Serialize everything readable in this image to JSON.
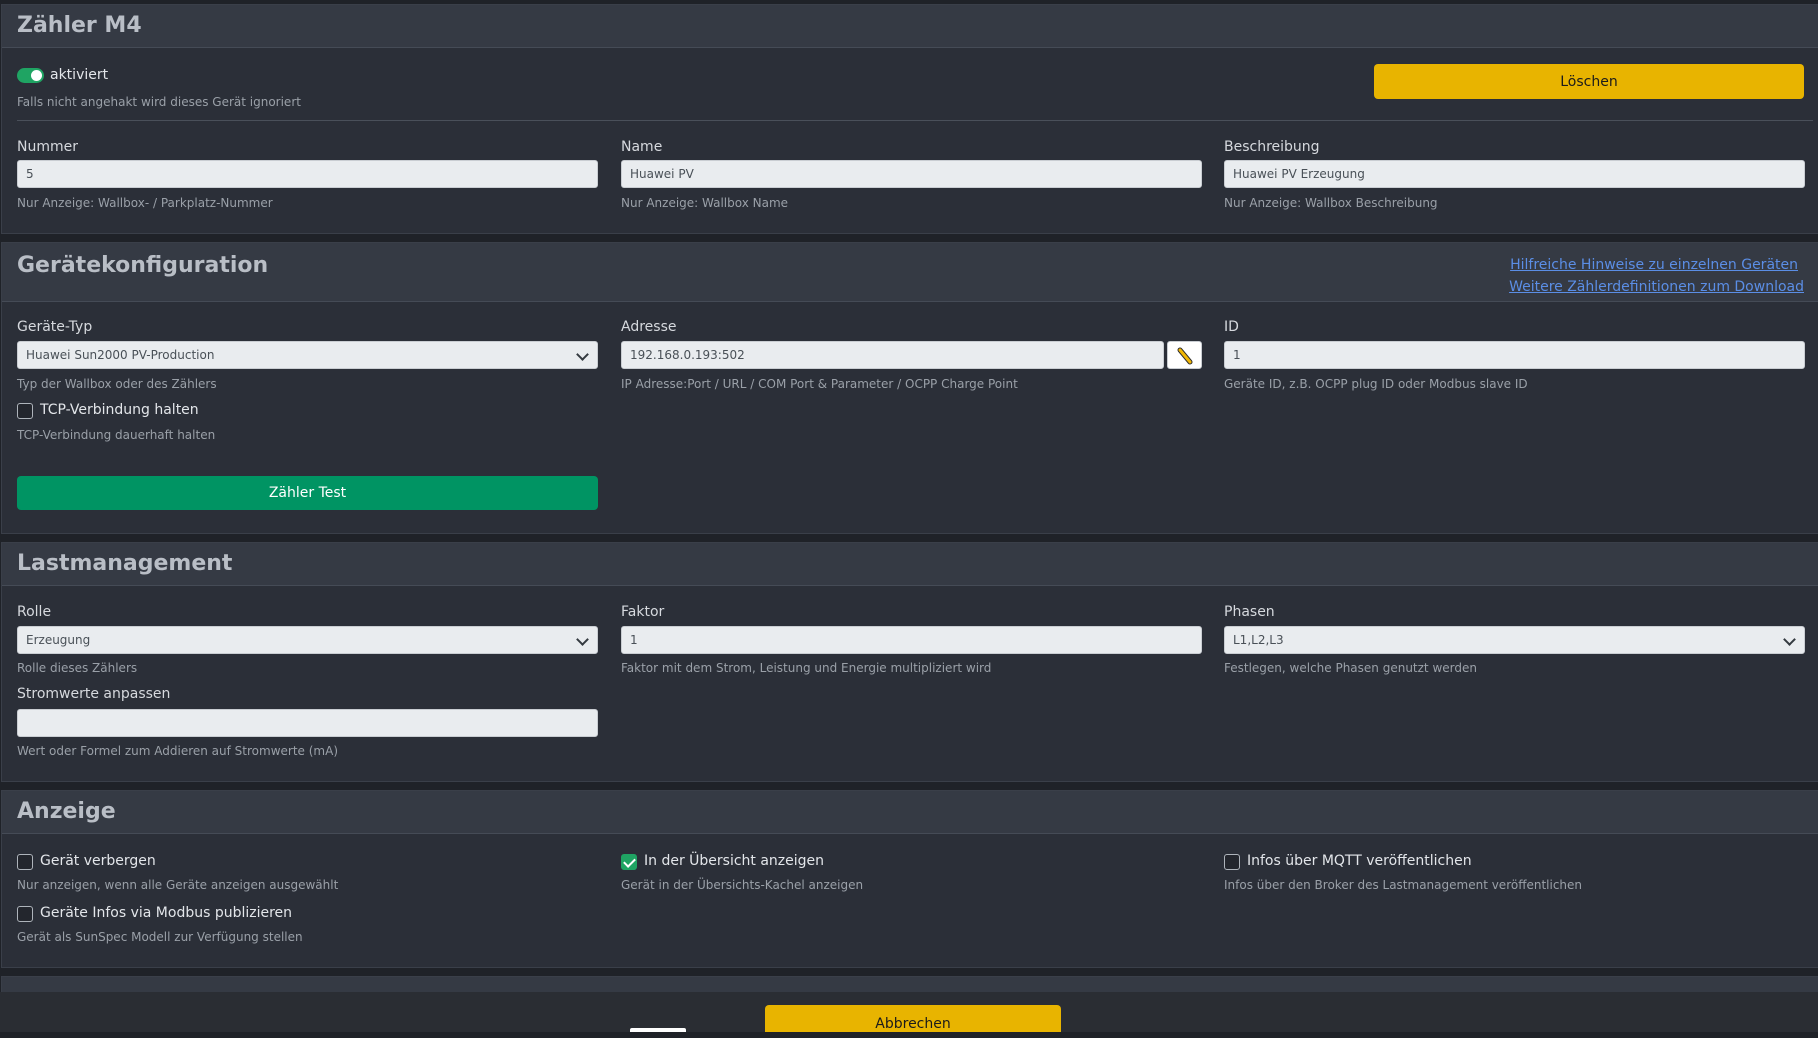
{
  "meter": {
    "title": "Zähler M4",
    "enabled_label": "aktiviert",
    "enabled_hint": "Falls nicht angehakt wird dieses Gerät ignoriert",
    "delete_label": "Löschen",
    "number": {
      "label": "Nummer",
      "value": "5",
      "hint": "Nur Anzeige: Wallbox- / Parkplatz-Nummer"
    },
    "name": {
      "label": "Name",
      "value": "Huawei PV",
      "hint": "Nur Anzeige: Wallbox Name"
    },
    "description": {
      "label": "Beschreibung",
      "value": "Huawei PV Erzeugung",
      "hint": "Nur Anzeige: Wallbox Beschreibung"
    }
  },
  "device": {
    "title": "Gerätekonfiguration",
    "link1": "Hilfreiche Hinweise zu einzelnen Geräten",
    "link2": "Weitere Zählerdefinitionen zum Download",
    "type": {
      "label": "Geräte-Typ",
      "value": "Huawei Sun2000 PV-Production",
      "hint": "Typ der Wallbox oder des Zählers"
    },
    "address": {
      "label": "Adresse",
      "value": "192.168.0.193:502",
      "hint": "IP Adresse:Port / URL / COM Port & Parameter / OCPP Charge Point"
    },
    "id": {
      "label": "ID",
      "value": "1",
      "hint": "Geräte ID, z.B. OCPP plug ID oder Modbus slave ID"
    },
    "tcp_label": "TCP-Verbindung halten",
    "tcp_hint": "TCP-Verbindung dauerhaft halten",
    "test_label": "Zähler Test"
  },
  "load": {
    "title": "Lastmanagement",
    "role": {
      "label": "Rolle",
      "value": "Erzeugung",
      "hint": "Rolle dieses Zählers"
    },
    "factor": {
      "label": "Faktor",
      "value": "1",
      "hint": "Faktor mit dem Strom, Leistung und Energie multipliziert wird"
    },
    "phases": {
      "label": "Phasen",
      "value": "L1,L2,L3",
      "hint": "Festlegen, welche Phasen genutzt werden"
    },
    "adjust": {
      "label": "Stromwerte anpassen",
      "value": "",
      "hint": "Wert oder Formel zum Addieren auf Stromwerte (mA)"
    }
  },
  "display": {
    "title": "Anzeige",
    "hide_label": "Gerät verbergen",
    "hide_hint": "Nur anzeigen, wenn alle Geräte anzeigen ausgewählt",
    "overview_label": "In der Übersicht anzeigen",
    "overview_hint": "Gerät in der Übersichts-Kachel anzeigen",
    "mqtt_label": "Infos über MQTT veröffentlichen",
    "mqtt_hint": "Infos über den Broker des Lastmanagement veröffentlichen",
    "modbus_label": "Geräte Infos via Modbus publizieren",
    "modbus_hint": "Gerät als SunSpec Modell zur Verfügung stellen"
  },
  "footer": {
    "cancel_label": "Abbrechen"
  },
  "colors": {
    "accent_yellow": "#e8b400",
    "accent_green": "#009463",
    "link": "#5b8ee6"
  }
}
